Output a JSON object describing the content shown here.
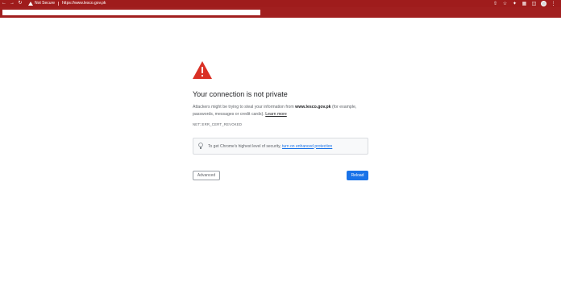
{
  "browser": {
    "not_secure_label": "Not Secure",
    "url": "https://www.lesco.gov.pk",
    "accent_color": "#9f1c1c"
  },
  "page": {
    "heading": "Your connection is not private",
    "body_part1": "Attackers might be trying to steal your information from ",
    "domain": "www.lesco.gov.pk",
    "body_part2": " (for example, passwords, messages or credit cards). ",
    "learn_more": "Learn more",
    "error_code": "NET::ERR_CERT_REVOKED",
    "tip_text": "To get Chrome's highest level of security, ",
    "tip_link": "turn on enhanced protection",
    "advanced_label": "Advanced",
    "reload_label": "Reload",
    "warning_color": "#d93025",
    "button_color": "#1a73e8"
  }
}
